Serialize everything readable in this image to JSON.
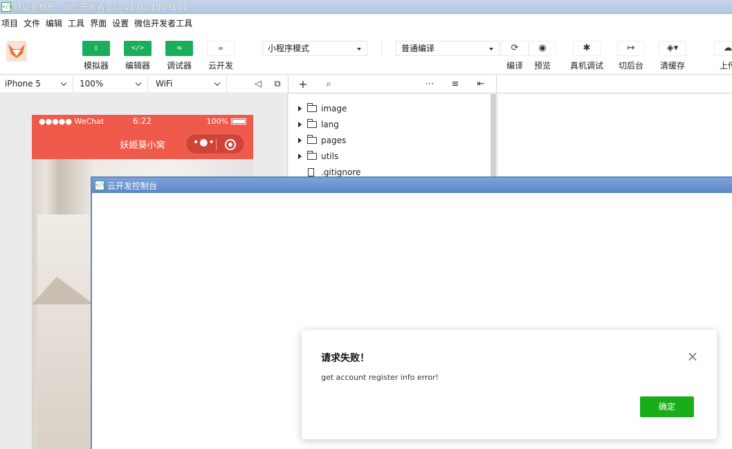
{
  "window": {
    "title": "妖姬葵相册 - 微信开发者工具 v1.02.1809101"
  },
  "menu": [
    "项目",
    "文件",
    "编辑",
    "工具",
    "界面",
    "设置",
    "微信开发者工具"
  ],
  "toolbar": {
    "left_tools": [
      {
        "label": "模拟器",
        "icon": "phone-icon"
      },
      {
        "label": "编辑器",
        "icon": "code-icon"
      },
      {
        "label": "调试器",
        "icon": "debug-icon"
      },
      {
        "label": "云开发",
        "icon": "cloud-link-icon"
      }
    ],
    "mode_select": "小程序模式",
    "compile_select": "普通编译",
    "right_tools": [
      {
        "label": "编译",
        "icon": "refresh-icon"
      },
      {
        "label": "预览",
        "icon": "eye-icon"
      },
      {
        "label": "真机调试",
        "icon": "bug-icon"
      },
      {
        "label": "切后台",
        "icon": "switch-icon"
      },
      {
        "label": "清缓存",
        "icon": "layers-icon"
      },
      {
        "label": "上传",
        "icon": "upload-icon"
      }
    ]
  },
  "subbar": {
    "device": "iPhone 5",
    "zoom": "100%",
    "network": "WiFi"
  },
  "simulator": {
    "status_left": "●●●●● WeChat",
    "status_time": "6:22",
    "status_battery": "100%",
    "nav_title": "妖姬葵小窝"
  },
  "file_tree": [
    {
      "name": "image",
      "type": "folder"
    },
    {
      "name": "lang",
      "type": "folder"
    },
    {
      "name": "pages",
      "type": "folder"
    },
    {
      "name": "utils",
      "type": "folder"
    },
    {
      "name": ".gitignore",
      "type": "file"
    }
  ],
  "cloud_console": {
    "title": "云开发控制台"
  },
  "dialog": {
    "title": "请求失败！",
    "message": "get account register info error!",
    "ok_label": "确定"
  },
  "colors": {
    "wechat_green": "#1aad19",
    "nav_red": "#f05a4b",
    "window_blue": "#5b87c7"
  }
}
